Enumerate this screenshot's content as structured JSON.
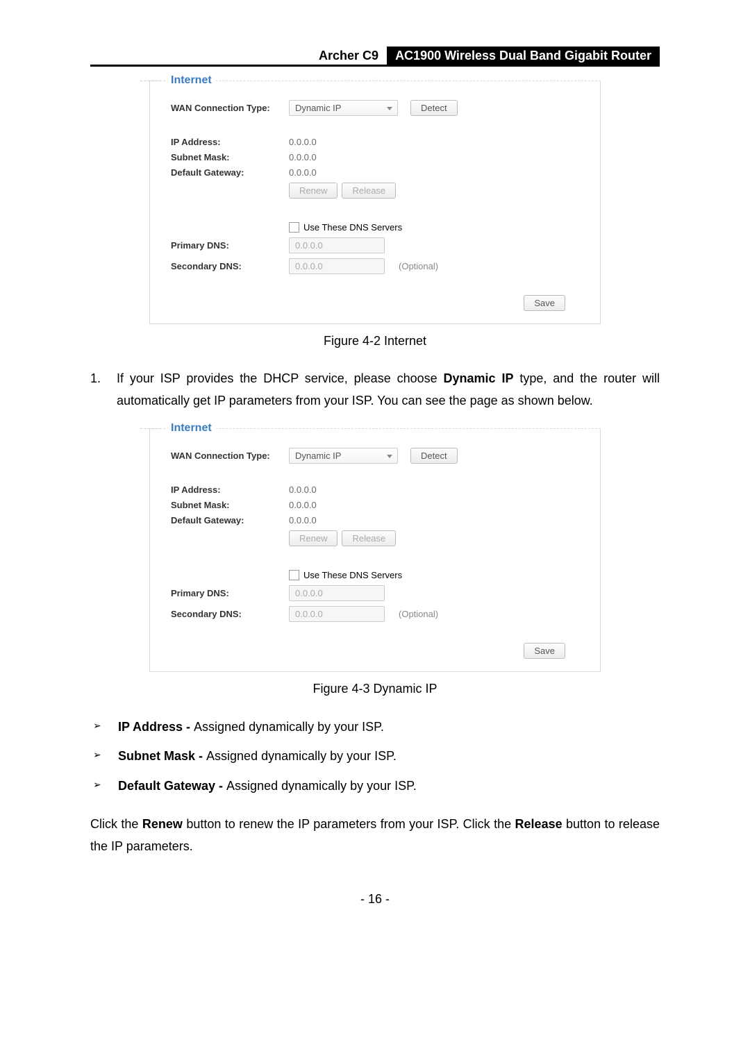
{
  "header": {
    "model": "Archer C9",
    "title": "AC1900 Wireless Dual Band Gigabit Router"
  },
  "figure1": {
    "legend": "Internet",
    "wan_label": "WAN Connection Type:",
    "wan_value": "Dynamic IP",
    "detect": "Detect",
    "ip_label": "IP Address:",
    "ip_value": "0.0.0.0",
    "mask_label": "Subnet Mask:",
    "mask_value": "0.0.0.0",
    "gw_label": "Default Gateway:",
    "gw_value": "0.0.0.0",
    "renew": "Renew",
    "release": "Release",
    "use_dns": "Use These DNS Servers",
    "pdns_label": "Primary DNS:",
    "pdns_value": "0.0.0.0",
    "sdns_label": "Secondary DNS:",
    "sdns_value": "0.0.0.0",
    "optional": "(Optional)",
    "save": "Save",
    "caption": "Figure 4-2 Internet"
  },
  "para1": {
    "num": "1.",
    "text_before": "If your ISP provides the DHCP service, please choose ",
    "bold": "Dynamic IP",
    "text_after": " type, and the router will automatically get IP parameters from your ISP. You can see the page as shown below."
  },
  "figure2": {
    "legend": "Internet",
    "wan_label": "WAN Connection Type:",
    "wan_value": "Dynamic IP",
    "detect": "Detect",
    "ip_label": "IP Address:",
    "ip_value": "0.0.0.0",
    "mask_label": "Subnet Mask:",
    "mask_value": "0.0.0.0",
    "gw_label": "Default Gateway:",
    "gw_value": "0.0.0.0",
    "renew": "Renew",
    "release": "Release",
    "use_dns": "Use These DNS Servers",
    "pdns_label": "Primary DNS:",
    "pdns_value": "0.0.0.0",
    "sdns_label": "Secondary DNS:",
    "sdns_value": "0.0.0.0",
    "optional": "(Optional)",
    "save": "Save",
    "caption": "Figure 4-3 Dynamic IP"
  },
  "bullets": [
    {
      "bold": "IP Address - ",
      "text": "Assigned dynamically by your ISP."
    },
    {
      "bold": "Subnet Mask - ",
      "text": "Assigned dynamically by your ISP."
    },
    {
      "bold": "Default Gateway - ",
      "text": "Assigned dynamically by your ISP."
    }
  ],
  "para2": {
    "t1": "Click the ",
    "b1": "Renew",
    "t2": " button to renew the IP parameters from your ISP. Click the ",
    "b2": "Release",
    "t3": " button to release the IP parameters."
  },
  "pagenum": "- 16 -"
}
